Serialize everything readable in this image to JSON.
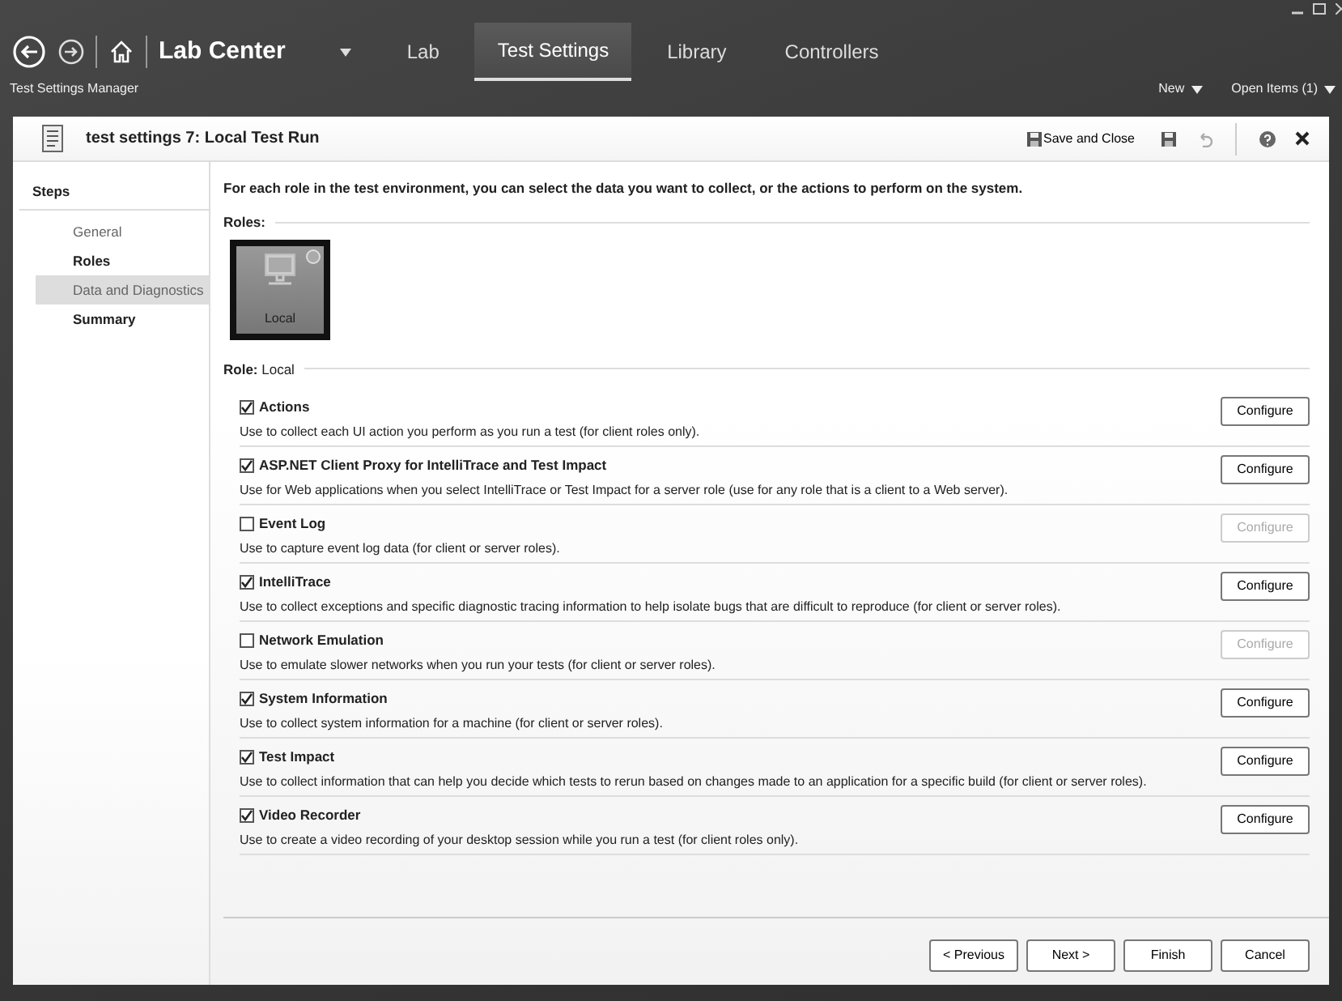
{
  "nav": {
    "title": "Lab Center",
    "tabs": [
      {
        "label": "Lab",
        "selected": false
      },
      {
        "label": "Test Settings",
        "selected": true
      },
      {
        "label": "Library",
        "selected": false
      },
      {
        "label": "Controllers",
        "selected": false
      }
    ]
  },
  "subbar": {
    "title": "Test Settings Manager",
    "menus": [
      "New",
      "Open Items (1)"
    ]
  },
  "document": {
    "title": "test settings 7: Local Test Run",
    "save_and_close": "Save and Close"
  },
  "steps": {
    "heading": "Steps",
    "items": [
      {
        "label": "General",
        "kind": "plain",
        "selected": false
      },
      {
        "label": "Roles",
        "kind": "bold",
        "selected": false
      },
      {
        "label": "Data and Diagnostics",
        "kind": "plain",
        "selected": true
      },
      {
        "label": "Summary",
        "kind": "bold",
        "selected": false
      }
    ]
  },
  "instruction": "For each role in the test environment, you can select the data you want to collect, or the actions to perform on the system.",
  "roles": {
    "label": "Roles:",
    "items": [
      {
        "label": "Local",
        "selected": true
      }
    ]
  },
  "role_line": "**Role:** Local",
  "collectors": [
    {
      "name": "Actions",
      "checked": true,
      "description": "Use to collect each UI action you perform as you run a test (for client roles only).",
      "button": {
        "label": "Configure",
        "disabled": false
      }
    },
    {
      "name": "ASP.NET Client Proxy for IntelliTrace and Test Impact",
      "checked": true,
      "description": "Use for Web applications when you select IntelliTrace or Test Impact for a server role (use for any role that is a client to a Web server).",
      "button": {
        "label": "Configure",
        "disabled": false
      }
    },
    {
      "name": "Event Log",
      "checked": false,
      "description": "Use to capture event log data (for client or server roles).",
      "button": {
        "label": "Configure",
        "disabled": true
      }
    },
    {
      "name": "IntelliTrace",
      "checked": true,
      "description": "Use to collect exceptions and specific diagnostic tracing information to help isolate bugs that are difficult to reproduce (for client or server roles).",
      "button": {
        "label": "Configure",
        "disabled": false
      }
    },
    {
      "name": "Network Emulation",
      "checked": false,
      "description": "Use to emulate slower networks when you run your tests (for client or server roles).",
      "button": {
        "label": "Configure",
        "disabled": true
      }
    },
    {
      "name": "System Information",
      "checked": true,
      "description": "Use to collect system information for a machine (for client or server roles).",
      "button": {
        "label": "Configure",
        "disabled": false
      }
    },
    {
      "name": "Test Impact",
      "checked": true,
      "description": "Use to collect information that can help you decide which tests to rerun based on changes made to an application for a specific build (for client or server roles).",
      "button": {
        "label": "Configure",
        "disabled": false
      }
    },
    {
      "name": "Video Recorder",
      "checked": true,
      "description": "Use to create a video recording of your desktop session while you run a test (for client roles only).",
      "button": {
        "label": "Configure",
        "disabled": false
      }
    }
  ],
  "footer_buttons": [
    "< Previous",
    "Next >",
    "Finish",
    "Cancel"
  ]
}
